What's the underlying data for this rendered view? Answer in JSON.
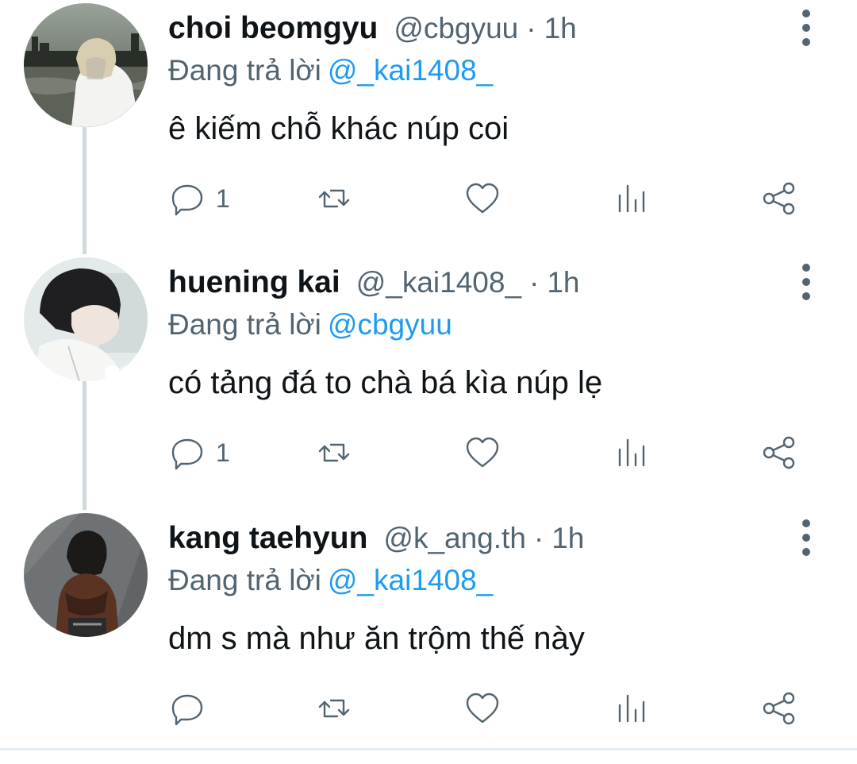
{
  "reply_prefix": "Đang trả lời",
  "dot": "·",
  "tweets": [
    {
      "name": "choi beomgyu",
      "handle": "@cbgyuu",
      "time": "1h",
      "reply_to": "@_kai1408_",
      "text": "ê kiếm chỗ khác núp coi",
      "reply_count": "1"
    },
    {
      "name": "huening kai",
      "handle": "@_kai1408_",
      "time": "1h",
      "reply_to": "@cbgyuu",
      "text": "có tảng đá to chà bá kìa núp lẹ",
      "reply_count": "1"
    },
    {
      "name": "kang taehyun",
      "handle": "@k_ang.th",
      "time": "1h",
      "reply_to": "@_kai1408_",
      "text": "dm s mà như ăn trộm thế này",
      "reply_count": ""
    }
  ],
  "icons": [
    "reply-icon",
    "retweet-icon",
    "like-icon",
    "views-icon",
    "share-icon",
    "more-icon"
  ],
  "colors": {
    "link": "#1d9bf0",
    "muted": "#536471",
    "thread_line": "#cfd9de"
  }
}
